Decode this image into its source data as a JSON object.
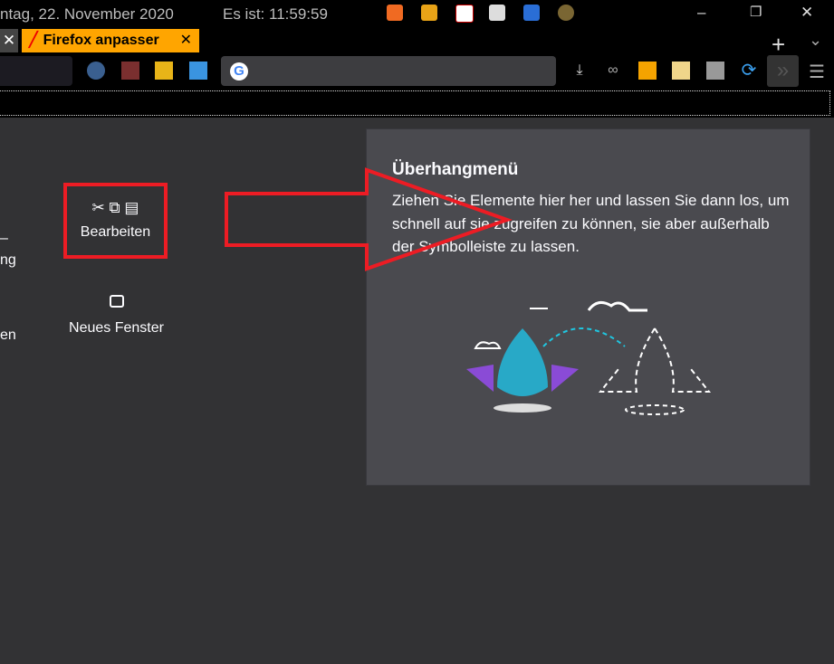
{
  "titlebar": {
    "date": "ntag, 22. November 2020",
    "clock": "Es ist:  11:59:59",
    "minimize": "–",
    "restore": "❐",
    "close": "✕"
  },
  "tabs": {
    "prev_close": "✕",
    "active_label": "Firefox anpasser",
    "active_close": "✕",
    "new_tab": "+",
    "list_all": "⌄"
  },
  "toolbar": {
    "overflow": "»",
    "menu": "☰",
    "download": "⤓"
  },
  "palette": {
    "partial_1": "–",
    "partial_2": "ng",
    "partial_3": "en",
    "edit_label": "Bearbeiten",
    "new_window_label": "Neues Fenster"
  },
  "overflow_panel": {
    "title": "Überhangmenü",
    "description": "Ziehen Sie Elemente hier her und lassen Sie dann los, um schnell auf sie zugreifen zu können, sie aber außerhalb der Symbolleiste zu lassen."
  },
  "colors": {
    "highlight": "#ed1c24",
    "active_tab": "#ffa500",
    "background": "#323234",
    "panel": "#4a4a4f"
  }
}
